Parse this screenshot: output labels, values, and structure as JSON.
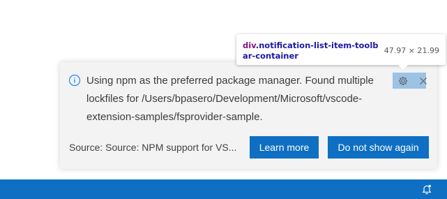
{
  "notification": {
    "message": "Using npm as the preferred package manager. Found multiple lockfiles for /Users/bpasero/Development/Microsoft/vscode-extension-samples/fsprovider-sample.",
    "source": "Source: Source: NPM support for VS...",
    "actions": {
      "learn_more": "Learn more",
      "do_not_show_again": "Do not show again"
    },
    "toolbar": {
      "settings_icon": "gear-icon",
      "close_icon": "close-icon"
    },
    "icon": "info-icon"
  },
  "inspector_tooltip": {
    "tag": "div",
    "class_name": ".notification-list-item-toolbar-container",
    "dimensions": "47.97 × 21.99"
  },
  "status_bar": {
    "bell_icon": "notification-bell-icon"
  },
  "colors": {
    "accent": "#0e6fc3",
    "info": "#1a85ff",
    "toast_background": "#f3f3f3",
    "text": "#3c3c3c"
  }
}
